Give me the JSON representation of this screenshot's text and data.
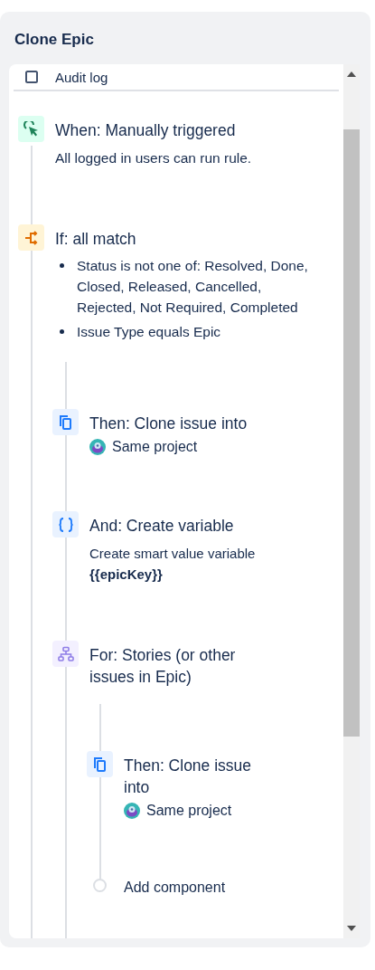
{
  "panel": {
    "title": "Clone Epic"
  },
  "audit_log": {
    "label": "Audit log"
  },
  "steps": [
    {
      "kind": "trigger",
      "title": "When: Manually triggered",
      "description": "All logged in users can run rule."
    },
    {
      "kind": "condition",
      "title": "If: all match",
      "bullets": [
        "Status is not one of: Resolved, Done, Closed, Released, Cancelled, Rejected, Not Required, Completed",
        "Issue Type equals Epic"
      ],
      "children": [
        {
          "kind": "clone",
          "title": "Then: Clone issue into",
          "project": "Same project"
        },
        {
          "kind": "variable",
          "title": "And: Create variable",
          "description": "Create smart value variable **{{epicKey}}**"
        },
        {
          "kind": "branch",
          "title": "For: Stories (or other issues in Epic)",
          "children": [
            {
              "kind": "clone",
              "title": "Then: Clone issue into",
              "project": "Same project"
            },
            {
              "kind": "add",
              "title": "Add component"
            }
          ]
        }
      ]
    }
  ]
}
